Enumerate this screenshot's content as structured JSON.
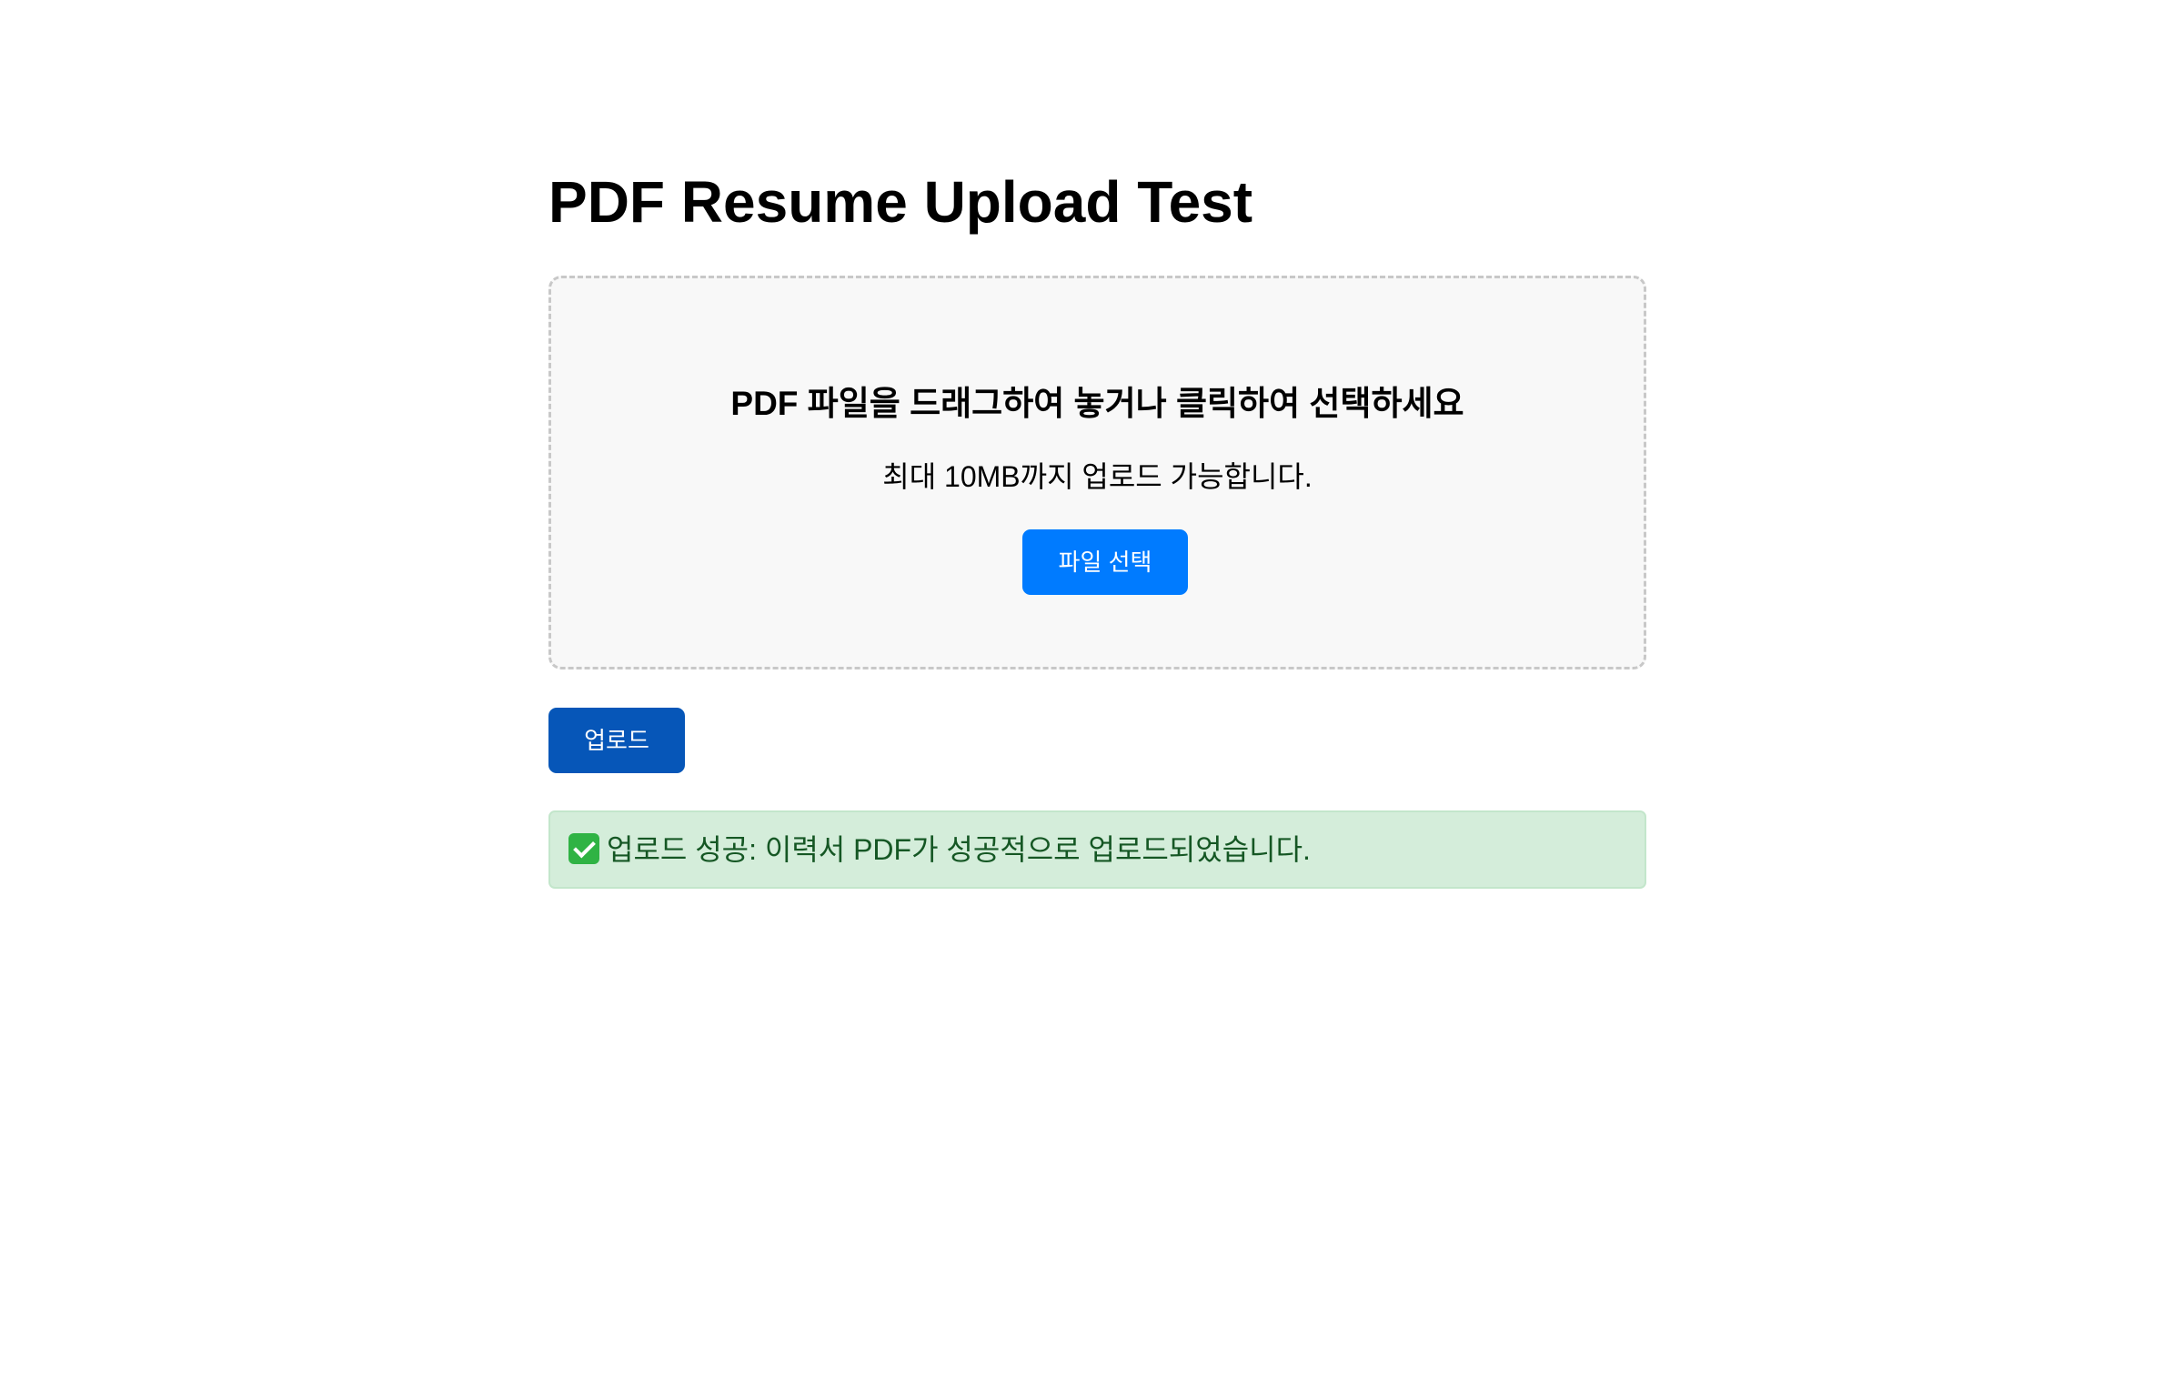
{
  "page": {
    "title": "PDF Resume Upload Test"
  },
  "dropzone": {
    "title": "PDF 파일을 드래그하여 놓거나 클릭하여 선택하세요",
    "hint": "최대 10MB까지 업로드 가능합니다.",
    "select_button_label": "파일 선택"
  },
  "actions": {
    "upload_button_label": "업로드"
  },
  "status": {
    "icon": "check-mark-icon",
    "prefix": "업로드 성공:",
    "message": "이력서 PDF가 성공적으로 업로드되었습니다.",
    "colors": {
      "background": "#d4edda",
      "border": "#c3e6cb",
      "text": "#155724"
    }
  },
  "colors": {
    "select_button": "#007bff",
    "upload_button": "#0656b8",
    "dropzone_background": "#f8f8f8",
    "dropzone_border": "#c8c8c8"
  }
}
